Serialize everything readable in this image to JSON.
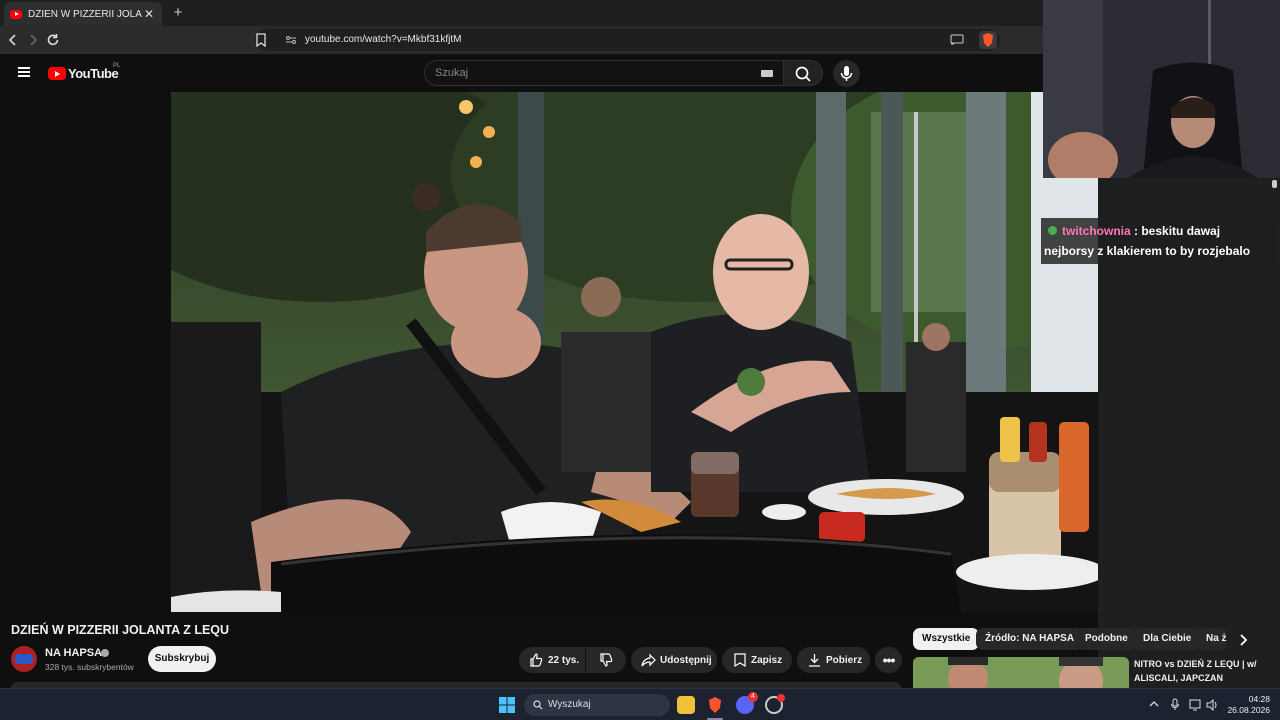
{
  "browser": {
    "tab_title": "DZIEŃ W PIZZERII JOLANTA Z LE",
    "tab_close": "✕",
    "new_tab": "+",
    "url": "youtube.com/watch?v=Mkbf31kfjtM"
  },
  "youtube": {
    "logo_text": "YouTube",
    "region": "PL",
    "search_placeholder": "Szukaj"
  },
  "chat": {
    "username": "twitchownia",
    "separator": " : ",
    "message": "beskitu dawaj nejborsy z klakierem to by rozjebalo"
  },
  "video": {
    "title": "DZIEŃ W PIZZERII JOLANTA Z LEQU",
    "channel_name": "NA HAPSA",
    "subscribers": "328 tys. subskrybentów",
    "subscribe_label": "Subskrybuj",
    "likes": "22 tys.",
    "share_label": "Udostępnij",
    "save_label": "Zapisz",
    "download_label": "Pobierz",
    "more_label": "•••"
  },
  "chips": [
    "Wszystkie",
    "Źródło: NA HAPSA",
    "Podobne",
    "Dla Ciebie",
    "Na ż"
  ],
  "recommendation": {
    "title": "NITRO vs DZIEŃ Z LEQU | w/ ALISCALI, JAPCZAN"
  },
  "taskbar": {
    "search_label": "Wyszukaj",
    "discord_badge": "4",
    "time": "04:28",
    "date": "26.08.2026"
  },
  "colors": {
    "youtube_red": "#ff0000",
    "chat_username": "#ff78b4",
    "background": "#0f0f0f"
  }
}
